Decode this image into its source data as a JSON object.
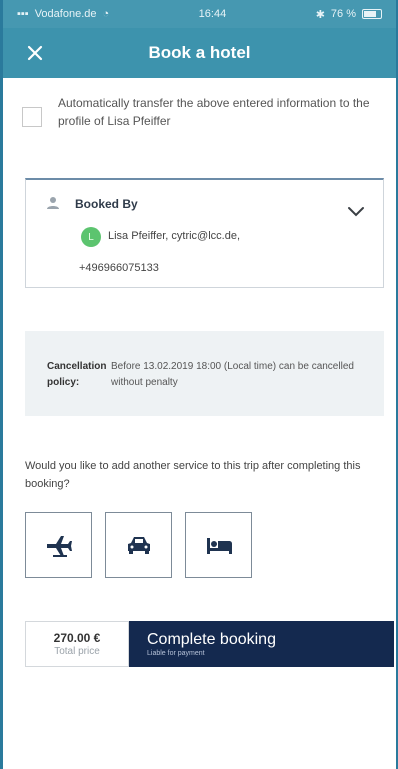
{
  "status_bar": {
    "carrier": "Vodafone.de",
    "time": "16:44",
    "battery": "76 %"
  },
  "header": {
    "title": "Book a hotel",
    "close_icon": "close-icon"
  },
  "transfer": {
    "text": "Automatically transfer the above entered information to the profile of Lisa Pfeiffer",
    "checked": false
  },
  "booked_by": {
    "label": "Booked By",
    "avatar_initial": "L",
    "name_email": "Lisa Pfeiffer, cytric@lcc.de,",
    "phone": "+496966075133"
  },
  "cancellation": {
    "label": "Cancellation policy:",
    "text": "Before 13.02.2019 18:00 (Local time) can be cancelled without penalty"
  },
  "question": "Would you like to add another service to this trip after completing this booking?",
  "services": [
    {
      "icon": "flight-icon",
      "name": "flight"
    },
    {
      "icon": "car-icon",
      "name": "car"
    },
    {
      "icon": "hotel-icon",
      "name": "hotel"
    }
  ],
  "footer": {
    "price": "270.00 €",
    "price_label": "Total price",
    "button_label": "Complete booking",
    "button_sublabel": "Liable for payment"
  },
  "colors": {
    "header": "#3d93ad",
    "button": "#14294f",
    "avatar": "#5cc46f"
  }
}
